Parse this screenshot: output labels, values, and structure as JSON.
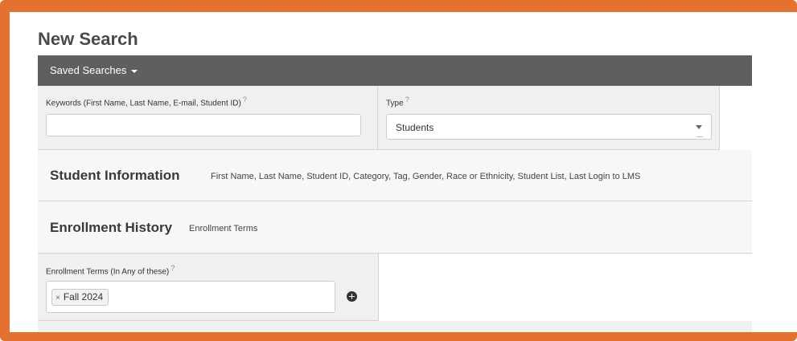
{
  "page": {
    "title": "New Search"
  },
  "saved_searches": {
    "label": "Saved Searches"
  },
  "keywords": {
    "label": "Keywords (First Name, Last Name, E-mail, Student ID)",
    "help": "?",
    "value": ""
  },
  "type": {
    "label": "Type",
    "help": "?",
    "selected": "Students"
  },
  "sections": {
    "student_info": {
      "title": "Student Information",
      "description": "First Name, Last Name, Student ID, Category, Tag, Gender, Race or Ethnicity, Student List, Last Login to LMS"
    },
    "enrollment_history": {
      "title": "Enrollment History",
      "description": "Enrollment Terms"
    }
  },
  "enrollment_terms": {
    "label": "Enrollment Terms (In Any of these)",
    "help": "?",
    "tags": [
      {
        "label": "Fall 2024",
        "remove": "×"
      }
    ]
  },
  "colors": {
    "frame": "#E4712F",
    "header_bar": "#5F5F5F",
    "panel": "#F0F0F0"
  },
  "icons": {
    "add": "plus-circle-icon",
    "remove": "close-icon",
    "dropdown": "chevron-down-icon"
  }
}
